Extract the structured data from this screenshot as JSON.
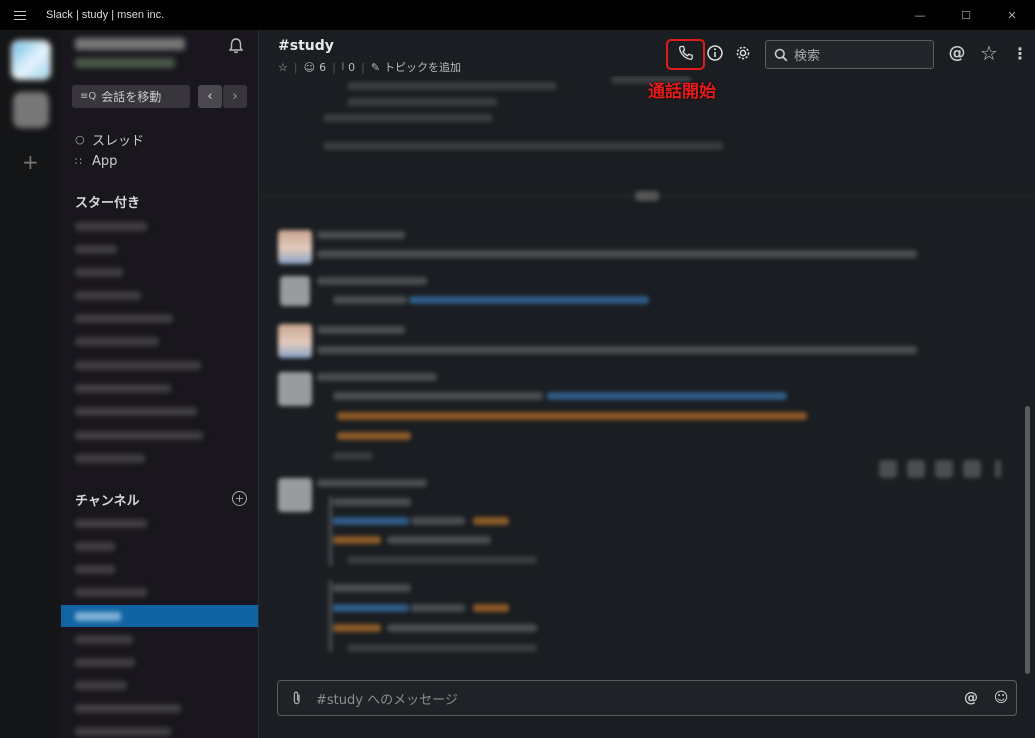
{
  "window": {
    "title": "Slack | study | msen inc."
  },
  "sidebar": {
    "jump_label": "会話を移動",
    "threads_label": "スレッド",
    "apps_label": "App",
    "starred_section": "スター付き",
    "channels_section": "チャンネル"
  },
  "channel": {
    "name": "#study",
    "members_count": "6",
    "pins_count": "0",
    "topic_label": "トピックを追加"
  },
  "header": {
    "search_placeholder": "検索"
  },
  "annotation": {
    "call_label": "通話開始"
  },
  "composer": {
    "placeholder": "#study へのメッセージ"
  },
  "colors": {
    "accent": "#1164a3",
    "annotation": "#e31b1b"
  }
}
